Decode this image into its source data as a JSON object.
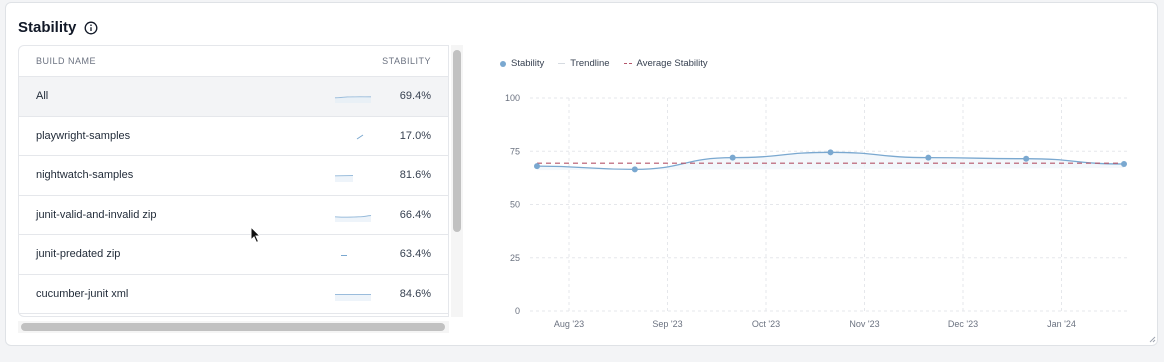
{
  "header": {
    "title": "Stability",
    "info_icon": "info-icon"
  },
  "table": {
    "columns": [
      "BUILD NAME",
      "STABILITY"
    ],
    "rows": [
      {
        "name": "All",
        "stability": "69.4%",
        "selected": true
      },
      {
        "name": "playwright-samples",
        "stability": "17.0%"
      },
      {
        "name": "nightwatch-samples",
        "stability": "81.6%"
      },
      {
        "name": "junit-valid-and-invalid zip",
        "stability": "66.4%"
      },
      {
        "name": "junit-predated zip",
        "stability": "63.4%"
      },
      {
        "name": "cucumber-junit xml",
        "stability": "84.6%"
      }
    ]
  },
  "legend": {
    "stability": "Stability",
    "trendline": "Trendline",
    "average": "Average Stability"
  },
  "colors": {
    "stability": "#7aa8d0",
    "trendline": "#d6dbe1",
    "average": "#b5566b"
  },
  "chart_data": {
    "type": "line",
    "ylim": [
      0,
      100
    ],
    "yticks": [
      0,
      25,
      50,
      75,
      100
    ],
    "xticks": [
      "Aug '23",
      "Sep '23",
      "Oct '23",
      "Nov '23",
      "Dec '23",
      "Jan '24"
    ],
    "series": [
      {
        "name": "Stability",
        "values": [
          68,
          66.5,
          72,
          74.5,
          72,
          71.5,
          69
        ]
      },
      {
        "name": "Average Stability",
        "values": [
          69.4,
          69.4
        ]
      }
    ],
    "grid": true,
    "legend_position": "top-left"
  }
}
